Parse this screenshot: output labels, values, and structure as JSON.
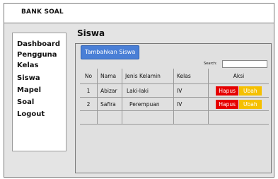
{
  "app": {
    "title": "BANK SOAL"
  },
  "sidebar": {
    "items": [
      {
        "label": "Dashboard"
      },
      {
        "label": "Pengguna"
      },
      {
        "label": "Kelas"
      },
      {
        "label": "Siswa",
        "active": true
      },
      {
        "label": "Mapel"
      },
      {
        "label": "Soal"
      },
      {
        "label": "Logout"
      }
    ]
  },
  "main": {
    "title": "Siswa",
    "add_button": "Tambahkan Siswa",
    "search": {
      "label": "Search:",
      "value": ""
    },
    "table": {
      "headers": [
        "No",
        "Nama",
        "Jenis Kelamin",
        "Kelas",
        "Aksi"
      ],
      "rows": [
        {
          "no": "1",
          "nama": "Abizar",
          "jenis_kelamin": "Laki-laki",
          "kelas": "IV",
          "hapus": "Hapus",
          "ubah": "Ubah"
        },
        {
          "no": "2",
          "nama": "Safira",
          "jenis_kelamin": "Perempuan",
          "kelas": "IV",
          "hapus": "Hapus",
          "ubah": "Ubah"
        }
      ]
    }
  },
  "colors": {
    "add_button": "#4a7fd6",
    "delete": "#e60000",
    "edit": "#f5c000"
  }
}
